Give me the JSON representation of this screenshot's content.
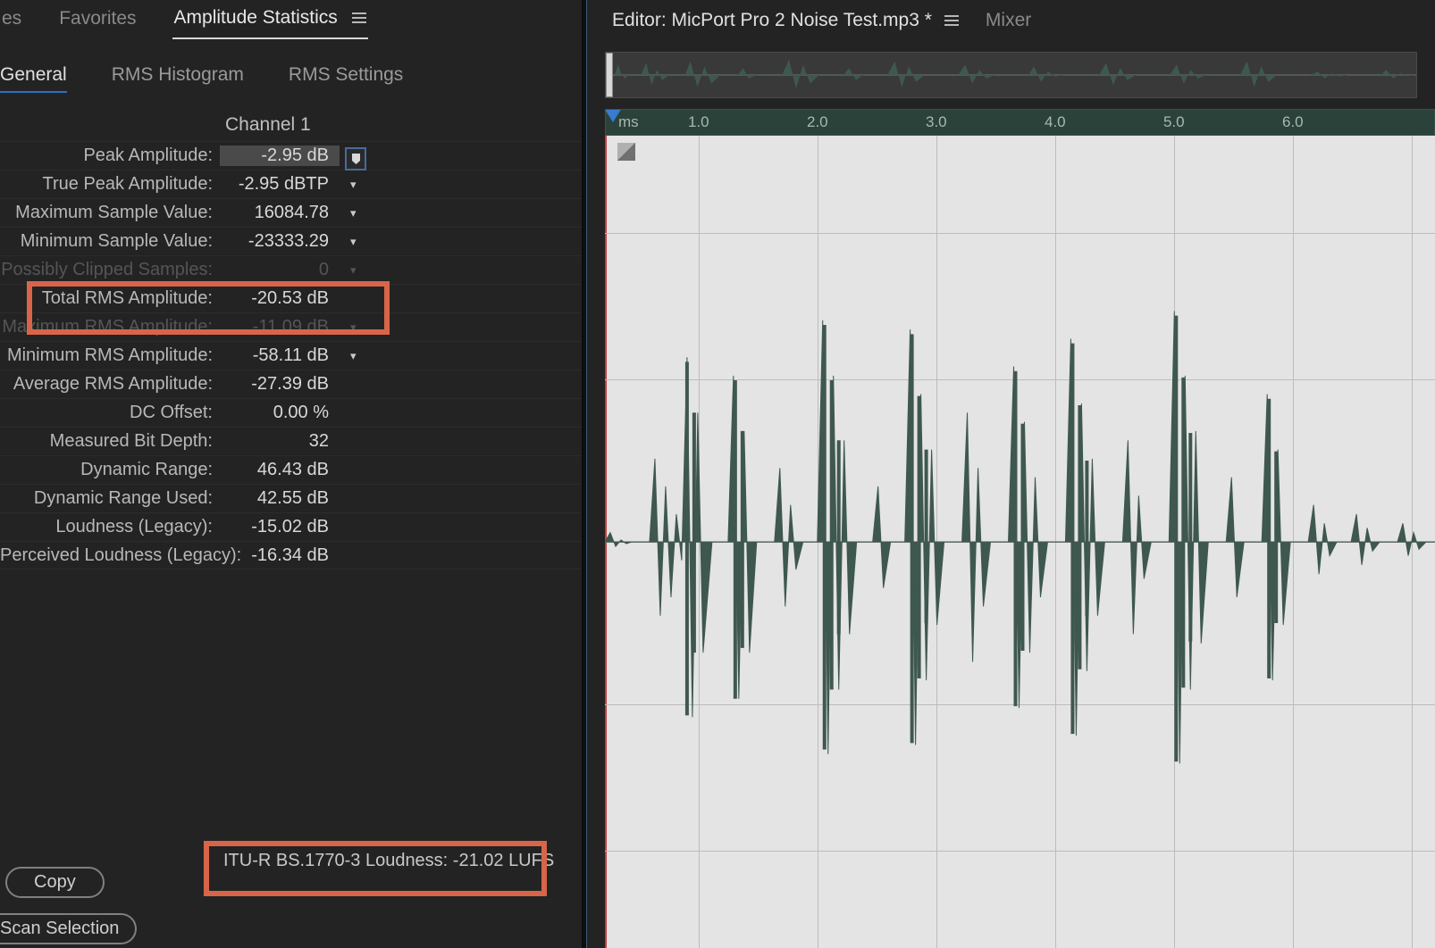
{
  "left": {
    "tabs": {
      "t0": "es",
      "t1": "Favorites",
      "t2": "Amplitude Statistics"
    },
    "subtabs": {
      "s0": "General",
      "s1": "RMS Histogram",
      "s2": "RMS Settings"
    },
    "channel_header": "Channel 1",
    "rows": {
      "r0": {
        "label": "Peak Amplitude:",
        "value": "-2.95 dB"
      },
      "r1": {
        "label": "True Peak Amplitude:",
        "value": "-2.95 dBTP"
      },
      "r2": {
        "label": "Maximum Sample Value:",
        "value": "16084.78"
      },
      "r3": {
        "label": "Minimum Sample Value:",
        "value": "-23333.29"
      },
      "r4": {
        "label": "Possibly Clipped Samples:",
        "value": "0"
      },
      "r5": {
        "label": "Total RMS Amplitude:",
        "value": "-20.53 dB"
      },
      "r6": {
        "label": "Maximum RMS Amplitude:",
        "value": "-11.09 dB"
      },
      "r7": {
        "label": "Minimum RMS Amplitude:",
        "value": "-58.11 dB"
      },
      "r8": {
        "label": "Average RMS Amplitude:",
        "value": "-27.39 dB"
      },
      "r9": {
        "label": "DC Offset:",
        "value": "0.00 %"
      },
      "r10": {
        "label": "Measured Bit Depth:",
        "value": "32"
      },
      "r11": {
        "label": "Dynamic Range:",
        "value": "46.43 dB"
      },
      "r12": {
        "label": "Dynamic Range Used:",
        "value": "42.55 dB"
      },
      "r13": {
        "label": "Loudness (Legacy):",
        "value": "-15.02 dB"
      },
      "r14": {
        "label": "Perceived Loudness (Legacy):",
        "value": "-16.34 dB"
      }
    },
    "lufs_line": "ITU-R BS.1770-3 Loudness:  -21.02 LUFS",
    "copy_label": "Copy",
    "scan_label": "Scan Selection"
  },
  "right": {
    "editor_tab": "Editor: MicPort Pro 2 Noise Test.mp3 *",
    "mixer_tab": "Mixer",
    "ruler_unit": "ms",
    "ruler_ticks": [
      "1.0",
      "2.0",
      "3.0",
      "4.0",
      "5.0",
      "6.0"
    ]
  }
}
